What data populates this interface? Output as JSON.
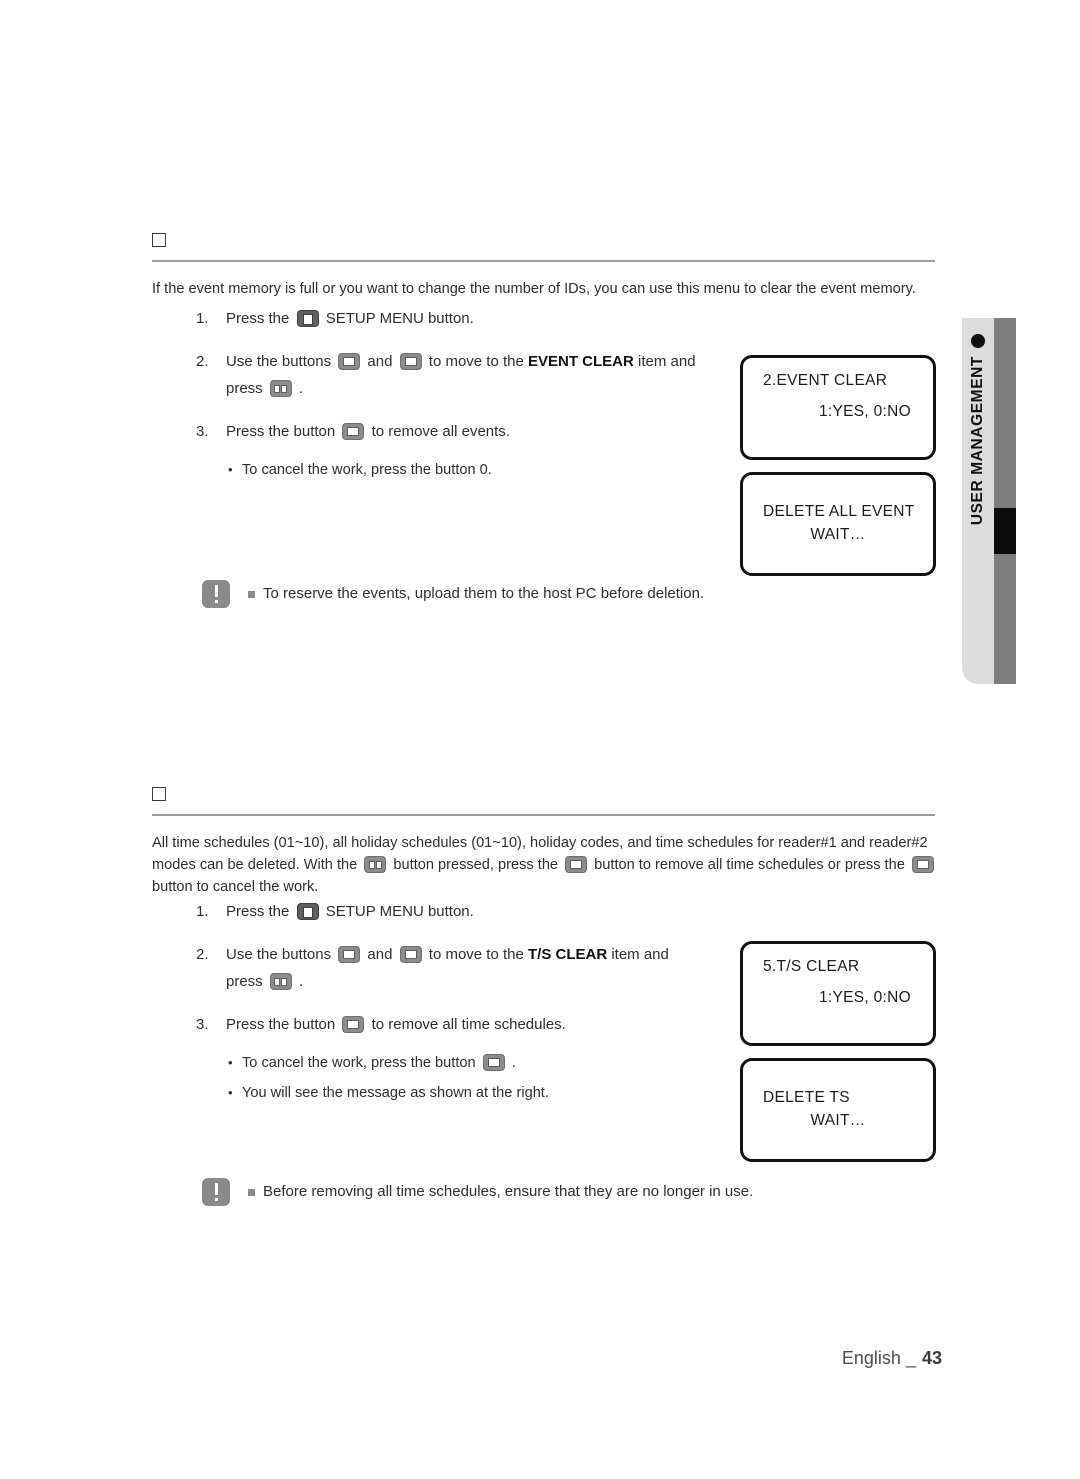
{
  "side_tab": {
    "label": "USER MANAGEMENT",
    "bullet_icon": "filled-circle-icon",
    "colors": {
      "light": "#dcdcdc",
      "dark": "#7e7e7e",
      "marker": "#0b0b0b"
    }
  },
  "sections": [
    {
      "id": "event-clear",
      "heading": "□",
      "intro": "If the event memory is full or you want to change the number of IDs, you can use this menu to clear the event memory.",
      "steps": [
        {
          "num": "1.",
          "parts": [
            "Press the ",
            "[key-menu]",
            " SETUP MENU button."
          ]
        },
        {
          "num": "2.",
          "line1_a": "Use the buttons ",
          "line1_b": " and ",
          "line1_c": " to move to the ",
          "bold": "EVENT CLEAR",
          "line1_d": " item and",
          "line2_a": "press ",
          "line2_b": " ."
        },
        {
          "num": "3.",
          "line1_a": "Press the button ",
          "line1_b": " to remove all events."
        }
      ],
      "bullets": [
        {
          "text": "To cancel the work, press the button 0."
        }
      ],
      "note": "To reserve the events, upload them to the host PC before deletion.",
      "lcd": [
        {
          "line1": "2.EVENT CLEAR",
          "line2": "1:YES, 0:NO"
        },
        {
          "line1": "DELETE ALL EVENT",
          "line2": "WAIT…"
        }
      ]
    },
    {
      "id": "ts-clear",
      "heading": "□",
      "intro_a": "All time schedules (01~10), all holiday schedules (01~10), holiday codes, and time schedules for reader#1 and reader#2 modes can be deleted. With the ",
      "intro_b": " button pressed, press the ",
      "intro_c": " button to remove all time schedules or press the ",
      "intro_d": " button to cancel the work.",
      "steps": [
        {
          "num": "1.",
          "parts": [
            "Press the ",
            "[key-menu]",
            " SETUP MENU button."
          ]
        },
        {
          "num": "2.",
          "line1_a": "Use the buttons ",
          "line1_b": " and ",
          "line1_c": " to move to the ",
          "bold": "T/S CLEAR",
          "line1_d": " item and",
          "line2_a": "press ",
          "line2_b": " ."
        },
        {
          "num": "3.",
          "line1_a": "Press the button ",
          "line1_b": " to remove all time schedules."
        }
      ],
      "bullets": [
        {
          "text_a": "To cancel the work, press the button ",
          "text_b": " ."
        },
        {
          "text": "You will see the message as shown at the right."
        }
      ],
      "note": "Before removing all time schedules, ensure that they are no longer in use.",
      "lcd": [
        {
          "line1": "5.T/S CLEAR",
          "line2": "1:YES, 0:NO"
        },
        {
          "line1": "DELETE TS",
          "line2": "WAIT…"
        }
      ]
    }
  ],
  "footer": {
    "language": "English _",
    "page": "43"
  }
}
